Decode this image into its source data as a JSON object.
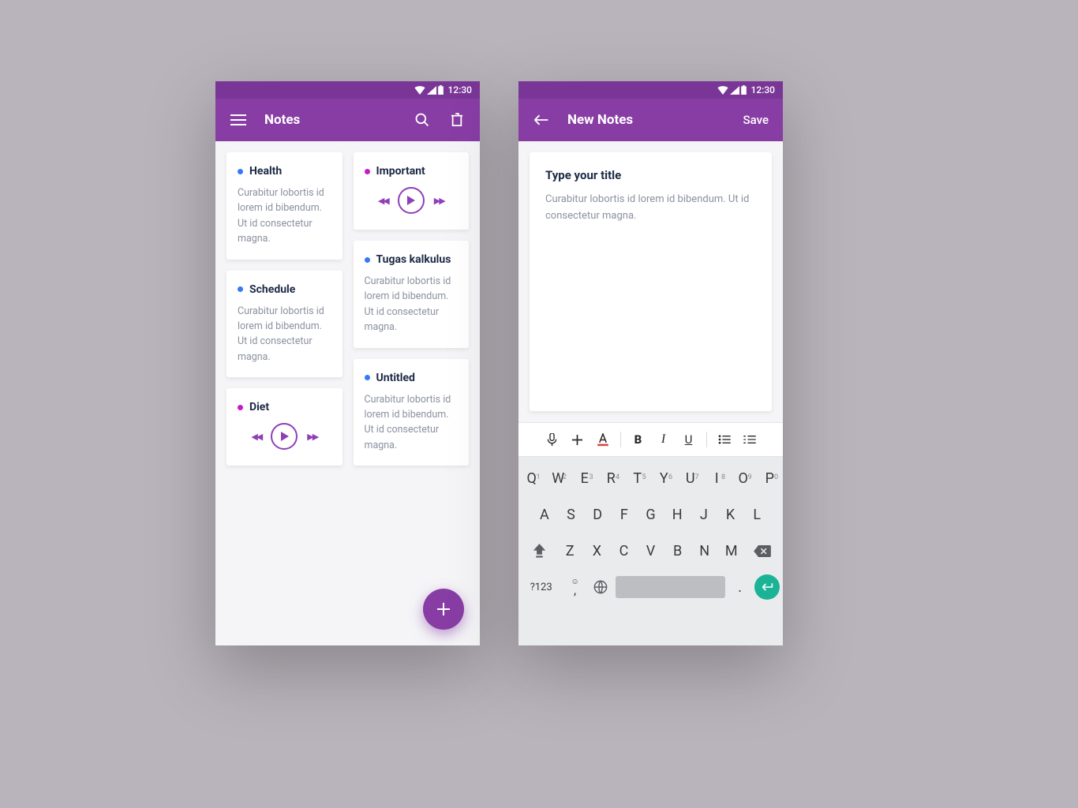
{
  "status": {
    "time": "12:30"
  },
  "colors": {
    "primary": "#883DA5",
    "primary_dark": "#7A3696",
    "dot_blue": "#3579F6",
    "dot_magenta": "#C41BCC",
    "enter_green": "#1BB396"
  },
  "left": {
    "title": "Notes",
    "cards_col1": [
      {
        "title": "Health",
        "dot": "blue",
        "type": "text",
        "body": "Curabitur lobortis id lorem id bibendum. Ut id consectetur magna."
      },
      {
        "title": "Schedule",
        "dot": "blue",
        "type": "text",
        "body": "Curabitur lobortis id lorem id bibendum. Ut id consectetur magna."
      },
      {
        "title": "Diet",
        "dot": "magenta",
        "type": "audio"
      }
    ],
    "cards_col2": [
      {
        "title": "Important",
        "dot": "magenta",
        "type": "audio"
      },
      {
        "title": "Tugas kalkulus",
        "dot": "blue",
        "type": "text",
        "body": "Curabitur lobortis id lorem id bibendum. Ut id consectetur magna."
      },
      {
        "title": "Untitled",
        "dot": "blue",
        "type": "text",
        "body": "Curabitur lobortis id lorem id bibendum. Ut id consectetur magna."
      }
    ]
  },
  "right": {
    "title": "New Notes",
    "save_label": "Save",
    "editor_title": "Type your title",
    "editor_body": "Curabitur lobortis id lorem id bibendum. Ut id consectetur magna."
  },
  "keyboard": {
    "row1": [
      {
        "k": "Q",
        "n": "1"
      },
      {
        "k": "W",
        "n": "2"
      },
      {
        "k": "E",
        "n": "3"
      },
      {
        "k": "R",
        "n": "4"
      },
      {
        "k": "T",
        "n": "5"
      },
      {
        "k": "Y",
        "n": "6"
      },
      {
        "k": "U",
        "n": "7"
      },
      {
        "k": "I",
        "n": "8"
      },
      {
        "k": "O",
        "n": "9"
      },
      {
        "k": "P",
        "n": "0"
      }
    ],
    "row2": [
      "A",
      "S",
      "D",
      "F",
      "G",
      "H",
      "J",
      "K",
      "L"
    ],
    "row3": [
      "Z",
      "X",
      "C",
      "V",
      "B",
      "N",
      "M"
    ],
    "sym_label": "?123",
    "period": "."
  }
}
